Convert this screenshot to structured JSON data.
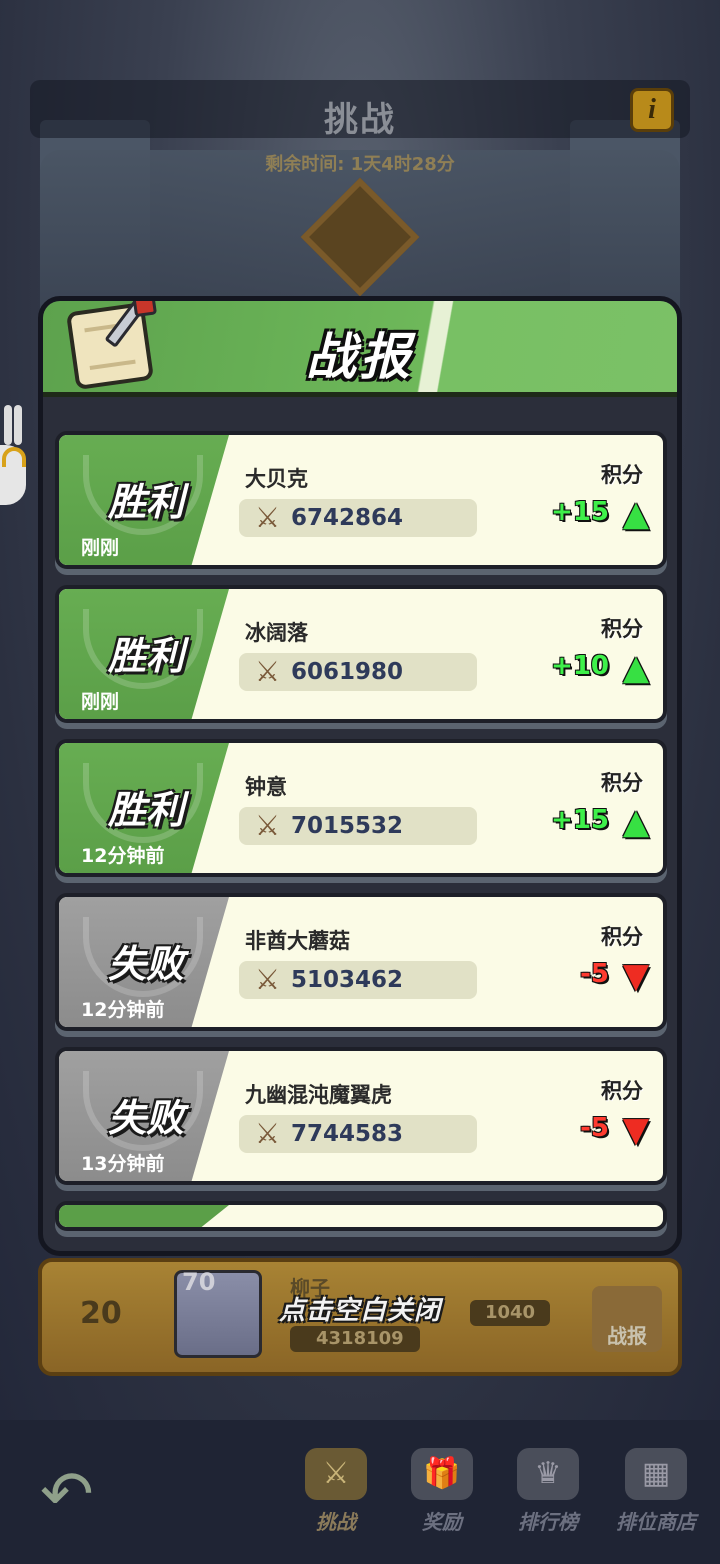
{
  "background": {
    "title": "挑战",
    "time_left": "剩余时间: 1天4时28分",
    "info_icon": "info-icon",
    "my_rank": {
      "rank": "20",
      "level": "70",
      "name": "柳子",
      "power": "4318109",
      "score": "1040",
      "report_label": "战报"
    }
  },
  "modal": {
    "title": "战报",
    "icon": "battle-scroll-icon",
    "score_label": "积分",
    "close_hint": "点击空白关闭",
    "reports": [
      {
        "result": "胜利",
        "outcome": "win",
        "when": "刚刚",
        "opponent": "大贝克",
        "power": "6742864",
        "delta": "+15",
        "arrow": "▲"
      },
      {
        "result": "胜利",
        "outcome": "win",
        "when": "刚刚",
        "opponent": "冰阔落",
        "power": "6061980",
        "delta": "+10",
        "arrow": "▲"
      },
      {
        "result": "胜利",
        "outcome": "win",
        "when": "12分钟前",
        "opponent": "钟意",
        "power": "7015532",
        "delta": "+15",
        "arrow": "▲"
      },
      {
        "result": "失败",
        "outcome": "lose",
        "when": "12分钟前",
        "opponent": "非酋大蘑菇",
        "power": "5103462",
        "delta": "-5",
        "arrow": "▼"
      },
      {
        "result": "失败",
        "outcome": "lose",
        "when": "13分钟前",
        "opponent": "九幽混沌魔翼虎",
        "power": "7744583",
        "delta": "-5",
        "arrow": "▼"
      }
    ]
  },
  "nav": {
    "back_icon": "back-arrow-icon",
    "tabs": [
      {
        "label": "挑战",
        "icon": "⚔",
        "active": true
      },
      {
        "label": "奖励",
        "icon": "🎁",
        "active": false
      },
      {
        "label": "排行榜",
        "icon": "♛",
        "active": false
      },
      {
        "label": "排位商店",
        "icon": "▦",
        "active": false
      }
    ]
  },
  "colors": {
    "win_green": "#5da24d",
    "lose_gray": "#9a9a9a",
    "card_bg": "#fbfbe6",
    "gain": "#3ef04a",
    "loss": "#ff3b30"
  }
}
